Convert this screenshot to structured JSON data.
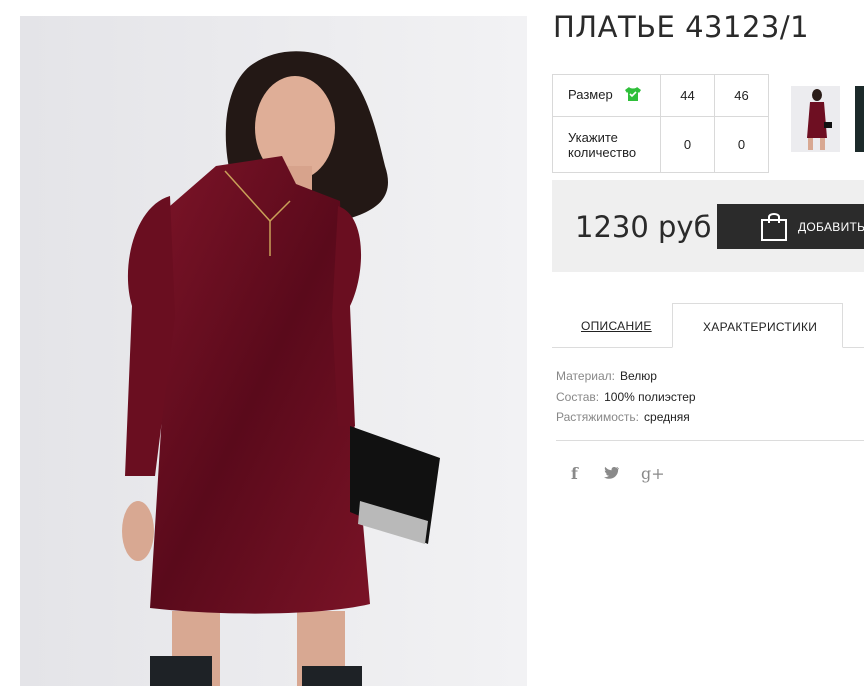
{
  "product": {
    "title": "ПЛАТЬЕ 43123/1",
    "price": "1230 руб",
    "add_to_cart_label": "ДОБАВИТЬ"
  },
  "sizes_table": {
    "size_label": "Размер",
    "quantity_label_line1": "Укажите",
    "quantity_label_line2": "количество",
    "sizes": [
      "44",
      "46"
    ],
    "quantities": [
      "0",
      "0"
    ],
    "size_chart_icon": "tshirt-icon",
    "size_chart_icon_color": "#2fbf3a"
  },
  "tabs": [
    {
      "label": "ОПИСАНИЕ",
      "active": false
    },
    {
      "label": "ХАРАКТЕРИСТИКИ",
      "active": true
    }
  ],
  "characteristics": [
    {
      "key": "Материал:",
      "value": "Велюр"
    },
    {
      "key": "Состав:",
      "value": "100% полиэстер"
    },
    {
      "key": "Растяжимость:",
      "value": "средняя"
    }
  ],
  "social": [
    {
      "name": "facebook-icon",
      "glyph": "f"
    },
    {
      "name": "twitter-icon",
      "glyph": ""
    },
    {
      "name": "google-plus-icon",
      "glyph": "g+"
    }
  ],
  "colors": {
    "dress": "#6e0f22",
    "cart_button": "#2b2b2b",
    "price_panel": "#efefef"
  }
}
